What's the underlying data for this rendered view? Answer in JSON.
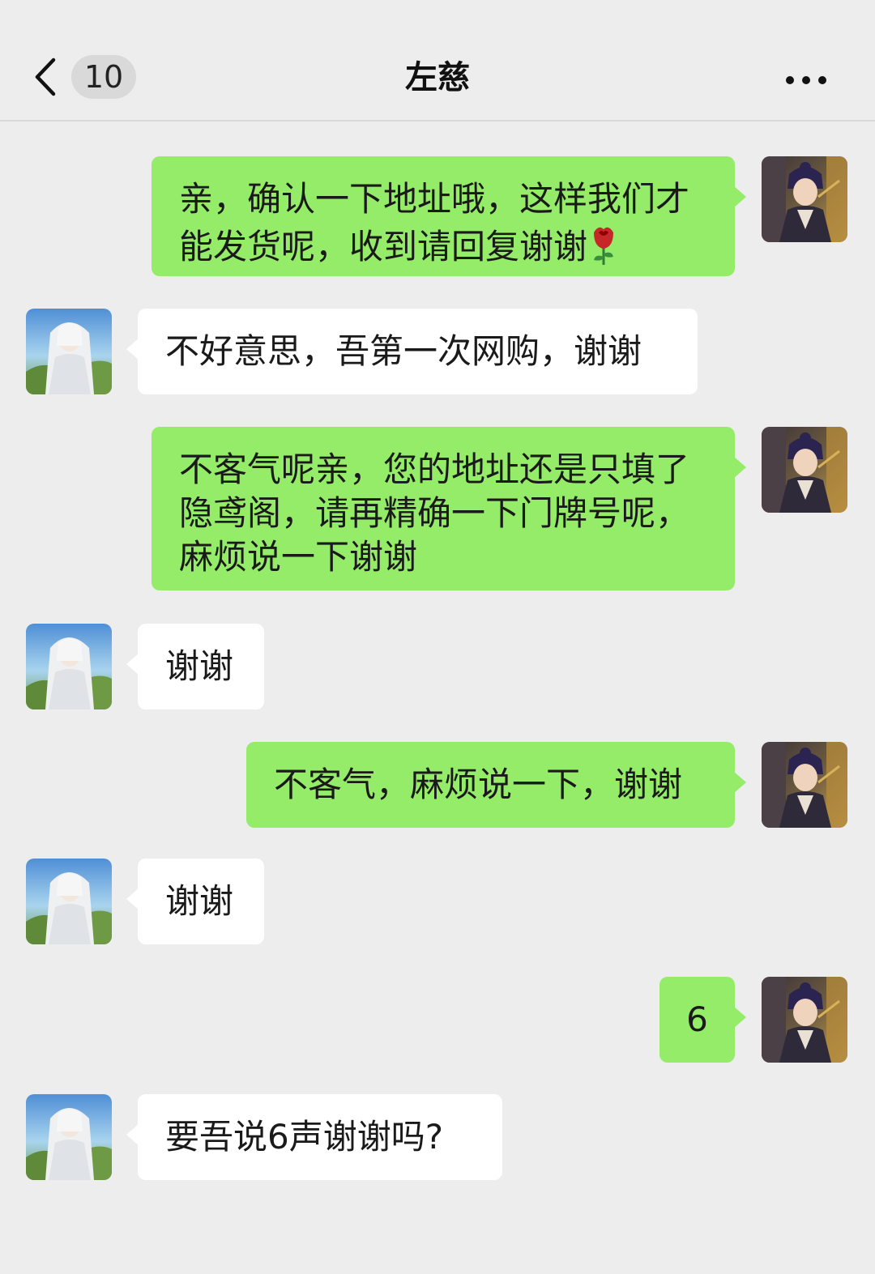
{
  "header": {
    "unread_count": "10",
    "title": "左慈"
  },
  "messages": [
    {
      "side": "right",
      "text": "亲，确认一下地址哦，这样我们才能发货呢，收到请回复谢谢",
      "emoji": "rose-icon"
    },
    {
      "side": "left",
      "text": "不好意思，吾第一次网购，谢谢"
    },
    {
      "side": "right",
      "text": "不客气呢亲，您的地址还是只填了隐鸢阁，请再精确一下门牌号呢，麻烦说一下谢谢"
    },
    {
      "side": "left",
      "text": "谢谢"
    },
    {
      "side": "right",
      "text": "不客气，麻烦说一下，谢谢"
    },
    {
      "side": "left",
      "text": "谢谢"
    },
    {
      "side": "right",
      "text": "6"
    },
    {
      "side": "left",
      "text": "要吾说6声谢谢吗?"
    }
  ],
  "colors": {
    "background": "#ededed",
    "sent_bubble": "#95ec69",
    "received_bubble": "#ffffff"
  }
}
